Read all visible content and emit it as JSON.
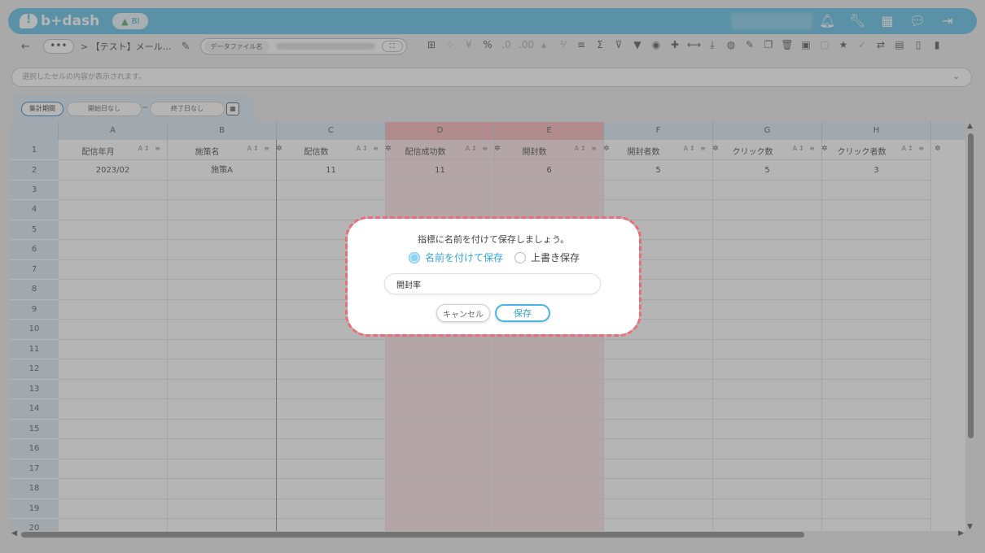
{
  "header": {
    "logo_text": "b+dash",
    "bi_badge": "BI",
    "icons": [
      "bell-icon",
      "wrench-icon",
      "grid-icon",
      "chat-icon",
      "logout-icon"
    ]
  },
  "toolbar": {
    "back": "←",
    "more": "•••",
    "breadcrumb": "> 【テスト】メール…",
    "file_label": "データファイル名",
    "expand": "⛶"
  },
  "formula_bar": {
    "placeholder": "選択したセルの内容が表示されます。"
  },
  "period": {
    "label": "集計期間",
    "start": "開始日なし",
    "tilde": "~",
    "end": "終了日なし"
  },
  "columns": [
    {
      "letter": "A",
      "header": "配信年月",
      "highlight": false
    },
    {
      "letter": "B",
      "header": "施策名",
      "highlight": false
    },
    {
      "letter": "C",
      "header": "配信数",
      "highlight": false
    },
    {
      "letter": "D",
      "header": "配信成功数",
      "highlight": true
    },
    {
      "letter": "E",
      "header": "開封数",
      "highlight": true
    },
    {
      "letter": "F",
      "header": "開封者数",
      "highlight": false
    },
    {
      "letter": "G",
      "header": "クリック数",
      "highlight": false
    },
    {
      "letter": "H",
      "header": "クリック者数",
      "highlight": false
    }
  ],
  "header_row_number": "1",
  "data_rows": [
    {
      "num": "2",
      "cells": [
        "2023/02",
        "施策A",
        "11",
        "11",
        "6",
        "5",
        "5",
        "3"
      ]
    }
  ],
  "empty_row_numbers": [
    "3",
    "4",
    "5",
    "6",
    "7",
    "8",
    "9",
    "10",
    "11",
    "12",
    "13",
    "14",
    "15",
    "16",
    "17",
    "18",
    "19",
    "20"
  ],
  "modal": {
    "title": "指標に名前を付けて保存しましょう。",
    "option_new": "名前を付けて保存",
    "option_overwrite": "上書き保存",
    "name_value": "開封率",
    "cancel": "キャンセル",
    "save": "保存"
  },
  "colors": {
    "brand": "#5bbde3",
    "highlight_column": "#f8b3b6",
    "modal_dash": "#ef6b78",
    "save_accent": "#48b6e6"
  }
}
